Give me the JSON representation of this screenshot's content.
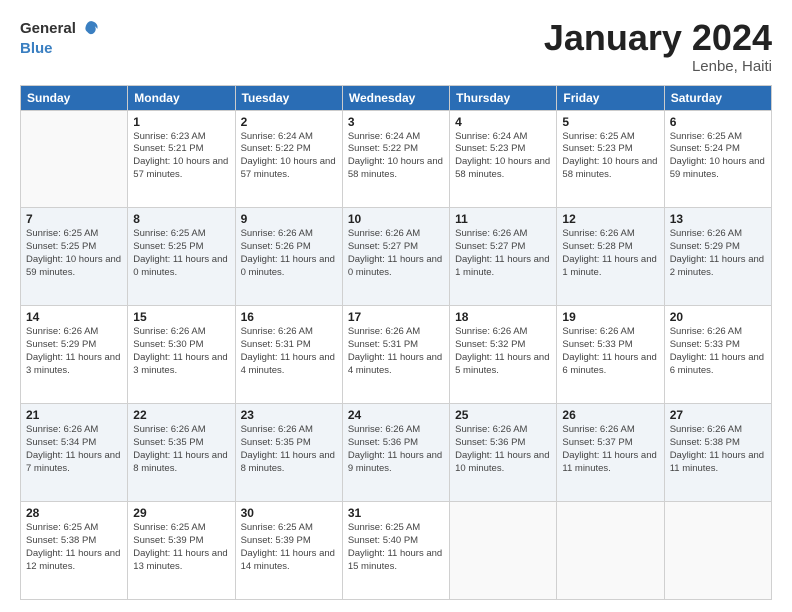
{
  "header": {
    "logo_general": "General",
    "logo_blue": "Blue",
    "title": "January 2024",
    "location": "Lenbe, Haiti"
  },
  "weekdays": [
    "Sunday",
    "Monday",
    "Tuesday",
    "Wednesday",
    "Thursday",
    "Friday",
    "Saturday"
  ],
  "weeks": [
    [
      {
        "day": "",
        "sunrise": "",
        "sunset": "",
        "daylight": ""
      },
      {
        "day": "1",
        "sunrise": "Sunrise: 6:23 AM",
        "sunset": "Sunset: 5:21 PM",
        "daylight": "Daylight: 10 hours and 57 minutes."
      },
      {
        "day": "2",
        "sunrise": "Sunrise: 6:24 AM",
        "sunset": "Sunset: 5:22 PM",
        "daylight": "Daylight: 10 hours and 57 minutes."
      },
      {
        "day": "3",
        "sunrise": "Sunrise: 6:24 AM",
        "sunset": "Sunset: 5:22 PM",
        "daylight": "Daylight: 10 hours and 58 minutes."
      },
      {
        "day": "4",
        "sunrise": "Sunrise: 6:24 AM",
        "sunset": "Sunset: 5:23 PM",
        "daylight": "Daylight: 10 hours and 58 minutes."
      },
      {
        "day": "5",
        "sunrise": "Sunrise: 6:25 AM",
        "sunset": "Sunset: 5:23 PM",
        "daylight": "Daylight: 10 hours and 58 minutes."
      },
      {
        "day": "6",
        "sunrise": "Sunrise: 6:25 AM",
        "sunset": "Sunset: 5:24 PM",
        "daylight": "Daylight: 10 hours and 59 minutes."
      }
    ],
    [
      {
        "day": "7",
        "sunrise": "Sunrise: 6:25 AM",
        "sunset": "Sunset: 5:25 PM",
        "daylight": "Daylight: 10 hours and 59 minutes."
      },
      {
        "day": "8",
        "sunrise": "Sunrise: 6:25 AM",
        "sunset": "Sunset: 5:25 PM",
        "daylight": "Daylight: 11 hours and 0 minutes."
      },
      {
        "day": "9",
        "sunrise": "Sunrise: 6:26 AM",
        "sunset": "Sunset: 5:26 PM",
        "daylight": "Daylight: 11 hours and 0 minutes."
      },
      {
        "day": "10",
        "sunrise": "Sunrise: 6:26 AM",
        "sunset": "Sunset: 5:27 PM",
        "daylight": "Daylight: 11 hours and 0 minutes."
      },
      {
        "day": "11",
        "sunrise": "Sunrise: 6:26 AM",
        "sunset": "Sunset: 5:27 PM",
        "daylight": "Daylight: 11 hours and 1 minute."
      },
      {
        "day": "12",
        "sunrise": "Sunrise: 6:26 AM",
        "sunset": "Sunset: 5:28 PM",
        "daylight": "Daylight: 11 hours and 1 minute."
      },
      {
        "day": "13",
        "sunrise": "Sunrise: 6:26 AM",
        "sunset": "Sunset: 5:29 PM",
        "daylight": "Daylight: 11 hours and 2 minutes."
      }
    ],
    [
      {
        "day": "14",
        "sunrise": "Sunrise: 6:26 AM",
        "sunset": "Sunset: 5:29 PM",
        "daylight": "Daylight: 11 hours and 3 minutes."
      },
      {
        "day": "15",
        "sunrise": "Sunrise: 6:26 AM",
        "sunset": "Sunset: 5:30 PM",
        "daylight": "Daylight: 11 hours and 3 minutes."
      },
      {
        "day": "16",
        "sunrise": "Sunrise: 6:26 AM",
        "sunset": "Sunset: 5:31 PM",
        "daylight": "Daylight: 11 hours and 4 minutes."
      },
      {
        "day": "17",
        "sunrise": "Sunrise: 6:26 AM",
        "sunset": "Sunset: 5:31 PM",
        "daylight": "Daylight: 11 hours and 4 minutes."
      },
      {
        "day": "18",
        "sunrise": "Sunrise: 6:26 AM",
        "sunset": "Sunset: 5:32 PM",
        "daylight": "Daylight: 11 hours and 5 minutes."
      },
      {
        "day": "19",
        "sunrise": "Sunrise: 6:26 AM",
        "sunset": "Sunset: 5:33 PM",
        "daylight": "Daylight: 11 hours and 6 minutes."
      },
      {
        "day": "20",
        "sunrise": "Sunrise: 6:26 AM",
        "sunset": "Sunset: 5:33 PM",
        "daylight": "Daylight: 11 hours and 6 minutes."
      }
    ],
    [
      {
        "day": "21",
        "sunrise": "Sunrise: 6:26 AM",
        "sunset": "Sunset: 5:34 PM",
        "daylight": "Daylight: 11 hours and 7 minutes."
      },
      {
        "day": "22",
        "sunrise": "Sunrise: 6:26 AM",
        "sunset": "Sunset: 5:35 PM",
        "daylight": "Daylight: 11 hours and 8 minutes."
      },
      {
        "day": "23",
        "sunrise": "Sunrise: 6:26 AM",
        "sunset": "Sunset: 5:35 PM",
        "daylight": "Daylight: 11 hours and 8 minutes."
      },
      {
        "day": "24",
        "sunrise": "Sunrise: 6:26 AM",
        "sunset": "Sunset: 5:36 PM",
        "daylight": "Daylight: 11 hours and 9 minutes."
      },
      {
        "day": "25",
        "sunrise": "Sunrise: 6:26 AM",
        "sunset": "Sunset: 5:36 PM",
        "daylight": "Daylight: 11 hours and 10 minutes."
      },
      {
        "day": "26",
        "sunrise": "Sunrise: 6:26 AM",
        "sunset": "Sunset: 5:37 PM",
        "daylight": "Daylight: 11 hours and 11 minutes."
      },
      {
        "day": "27",
        "sunrise": "Sunrise: 6:26 AM",
        "sunset": "Sunset: 5:38 PM",
        "daylight": "Daylight: 11 hours and 11 minutes."
      }
    ],
    [
      {
        "day": "28",
        "sunrise": "Sunrise: 6:25 AM",
        "sunset": "Sunset: 5:38 PM",
        "daylight": "Daylight: 11 hours and 12 minutes."
      },
      {
        "day": "29",
        "sunrise": "Sunrise: 6:25 AM",
        "sunset": "Sunset: 5:39 PM",
        "daylight": "Daylight: 11 hours and 13 minutes."
      },
      {
        "day": "30",
        "sunrise": "Sunrise: 6:25 AM",
        "sunset": "Sunset: 5:39 PM",
        "daylight": "Daylight: 11 hours and 14 minutes."
      },
      {
        "day": "31",
        "sunrise": "Sunrise: 6:25 AM",
        "sunset": "Sunset: 5:40 PM",
        "daylight": "Daylight: 11 hours and 15 minutes."
      },
      {
        "day": "",
        "sunrise": "",
        "sunset": "",
        "daylight": ""
      },
      {
        "day": "",
        "sunrise": "",
        "sunset": "",
        "daylight": ""
      },
      {
        "day": "",
        "sunrise": "",
        "sunset": "",
        "daylight": ""
      }
    ]
  ]
}
